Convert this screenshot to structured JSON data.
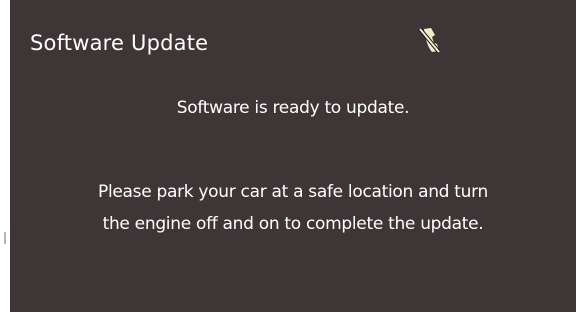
{
  "header": {
    "title": "Software Update",
    "status_icon": "phone-crossed-icon"
  },
  "message": {
    "ready": "Software is ready to update.",
    "instruction_line1": "Please park your car at a safe location and turn",
    "instruction_line2": "the engine off and on to complete the update."
  },
  "colors": {
    "background": "#3d3536",
    "text": "#ffffff",
    "icon_body": "#f2eccd"
  }
}
